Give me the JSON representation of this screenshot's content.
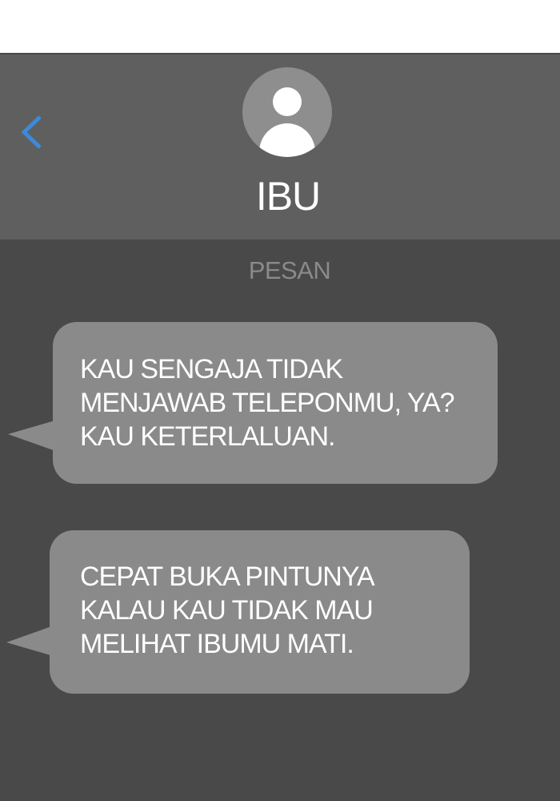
{
  "header": {
    "back_icon": "chevron-left-icon",
    "avatar_icon": "person-icon",
    "contact_name": "IBU"
  },
  "thread": {
    "section_label": "PESAN",
    "messages": [
      {
        "direction": "incoming",
        "lines": [
          "KAU SENGAJA TIDAK",
          "MENJAWAB TELEPONMU, YA?",
          "KAU KETERLALUAN."
        ]
      },
      {
        "direction": "incoming",
        "lines": [
          "CEPAT BUKA PINTUNYA",
          "KALAU KAU TIDAK MAU",
          "MELIHAT IBUMU MATI."
        ]
      }
    ]
  },
  "colors": {
    "accent": "#3d8ad8",
    "background": "#494949",
    "header_background": "#5f5f5f",
    "bubble": "#8a8a8a",
    "avatar_background": "#8e8e8e",
    "text": "#ffffff",
    "muted_text": "#8a8a8a"
  }
}
